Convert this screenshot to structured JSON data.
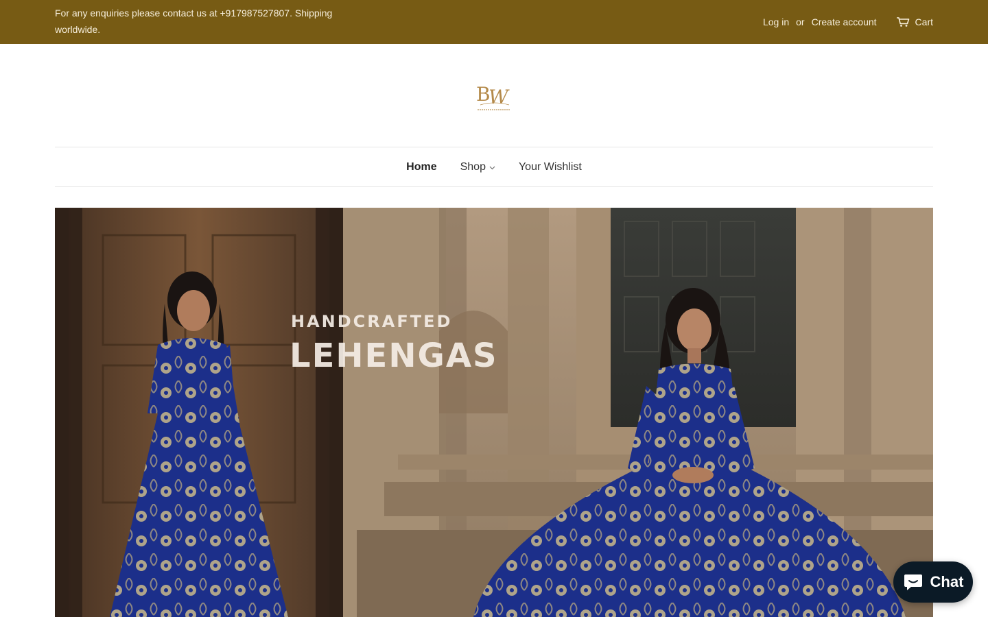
{
  "colors": {
    "announcement_bar": "#775b14",
    "logo_gold": "#b48a4a",
    "chat_button": "#0b1a26"
  },
  "announcement": {
    "message": "For any enquiries please contact us at +917987527807. Shipping worldwide.",
    "login": "Log in",
    "or": "or",
    "create_account": "Create account",
    "cart": "Cart",
    "cart_icon": "cart-icon"
  },
  "header": {
    "logo_icon": "banaras-weaves-logo"
  },
  "nav": {
    "items": [
      {
        "label": "Home",
        "active": true
      },
      {
        "label": "Shop",
        "dropdown": true
      },
      {
        "label": "Your Wishlist"
      }
    ]
  },
  "hero": {
    "caption_line1": "HANDCRAFTED",
    "caption_line2": "LEHENGAS"
  },
  "chat": {
    "label": "Chat",
    "icon": "chat-bubble-icon"
  }
}
